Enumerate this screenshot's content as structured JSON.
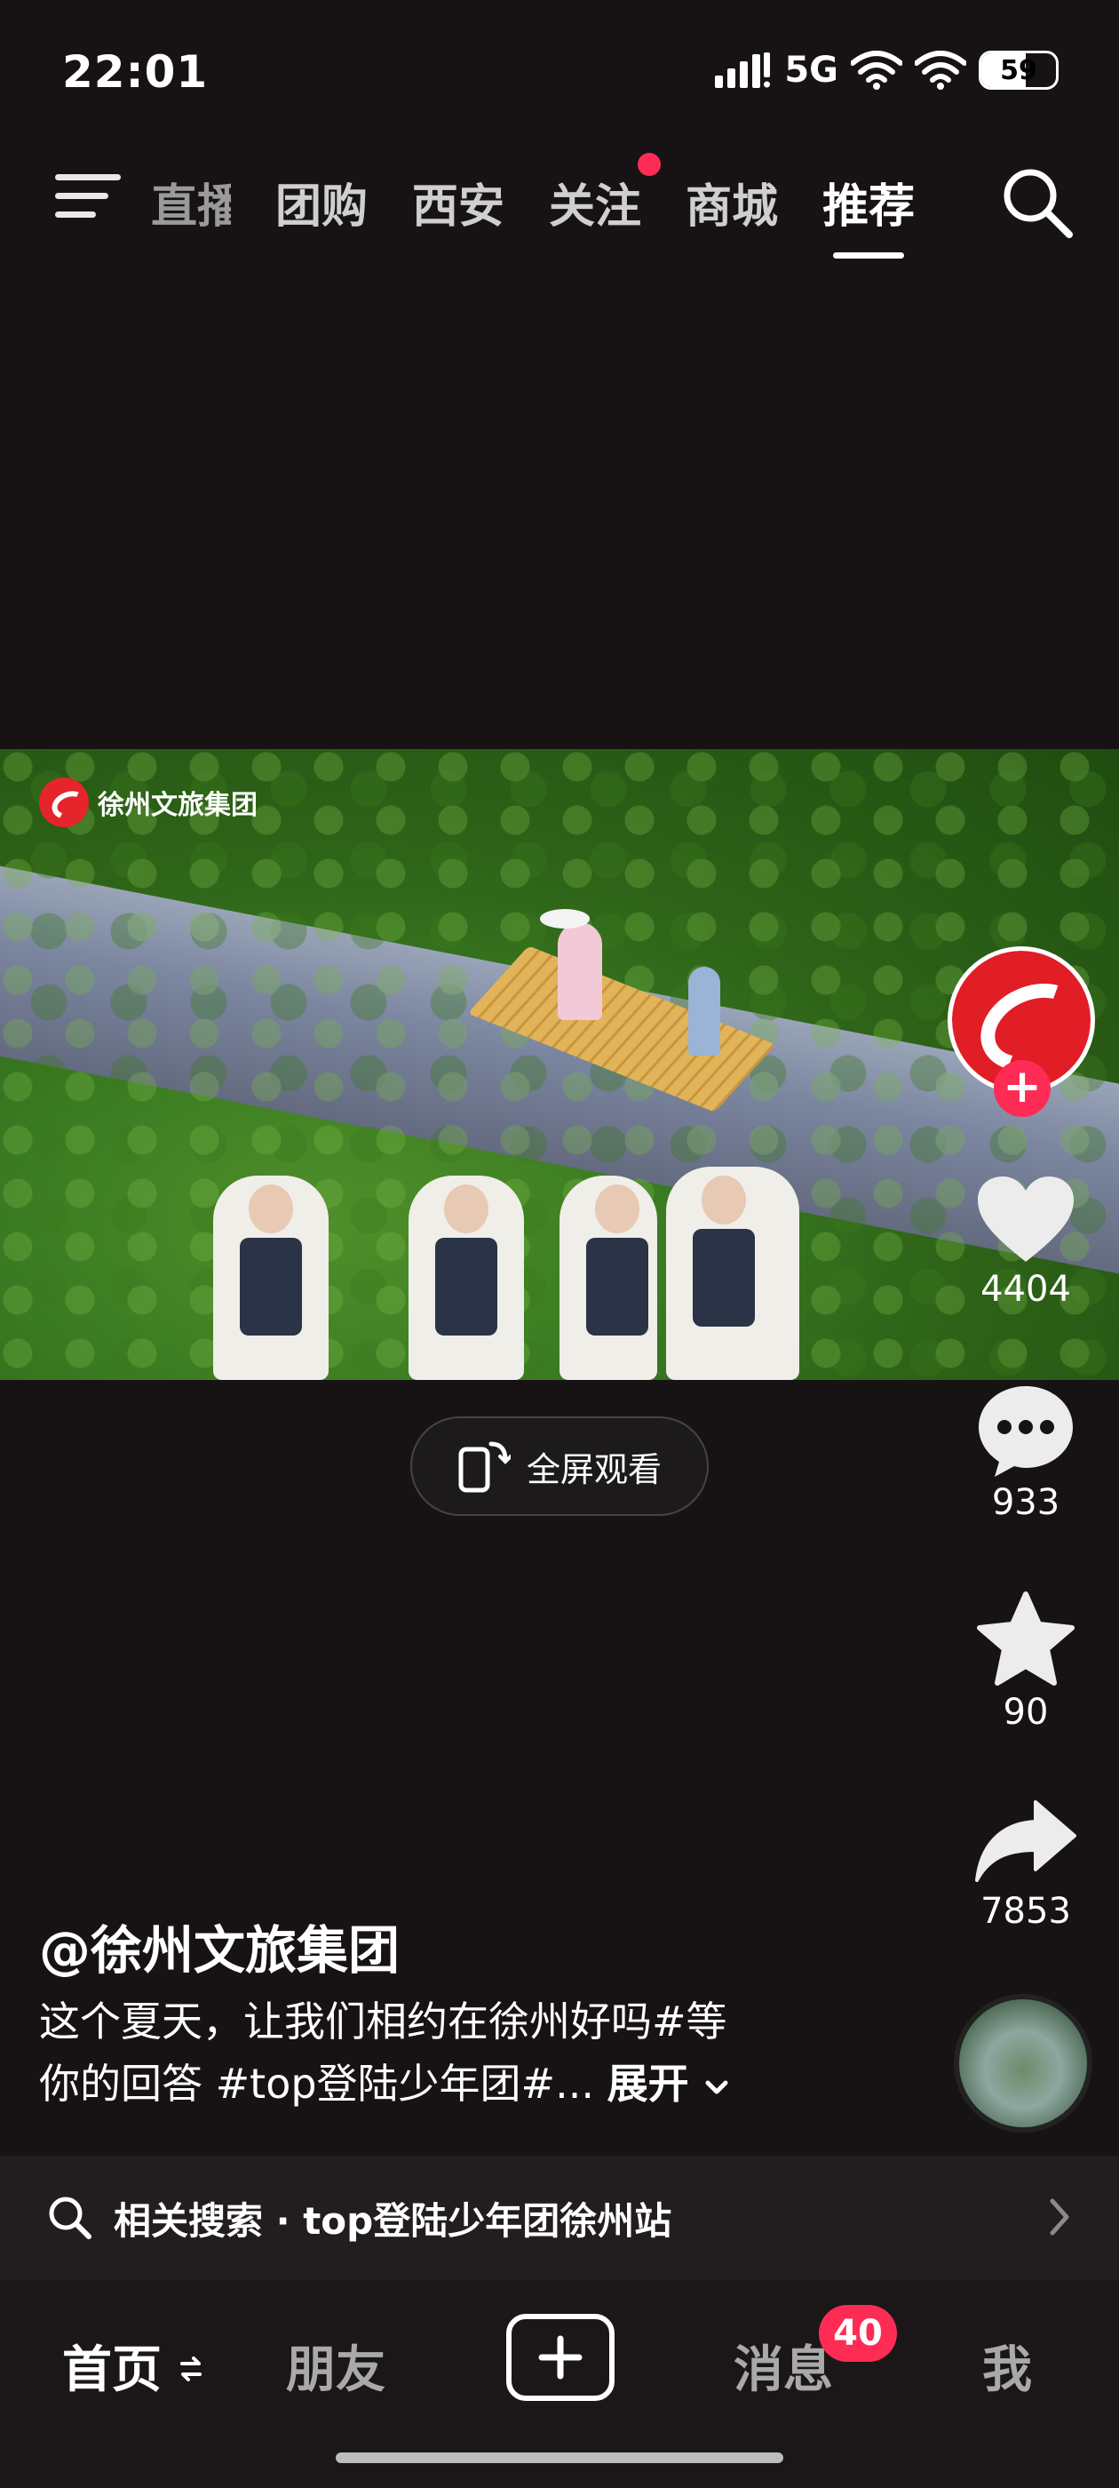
{
  "status_bar": {
    "time": "22:01",
    "network": "5G",
    "battery": "59"
  },
  "top_nav": {
    "tabs": [
      "直播",
      "团购",
      "西安",
      "关注",
      "商城",
      "推荐"
    ],
    "active_tab": "推荐"
  },
  "video": {
    "watermark": "徐州文旅集团",
    "fullscreen_label": "全屏观看"
  },
  "right_rail": {
    "likes": "4404",
    "comments": "933",
    "favorites": "90",
    "shares": "7853"
  },
  "post": {
    "author": "@徐州文旅集团",
    "caption_line1": "这个夏天，让我们相约在徐州好吗#等",
    "caption_line2": "你的回答 #top登陆少年团#...",
    "expand_label": "展开"
  },
  "related_search": {
    "label": "相关搜索 · top登陆少年团徐州站"
  },
  "bottom_nav": {
    "home": "首页",
    "friends": "朋友",
    "messages": "消息",
    "messages_badge": "40",
    "me": "我"
  },
  "colors": {
    "accent": "#fe2c55",
    "background": "#171314"
  }
}
